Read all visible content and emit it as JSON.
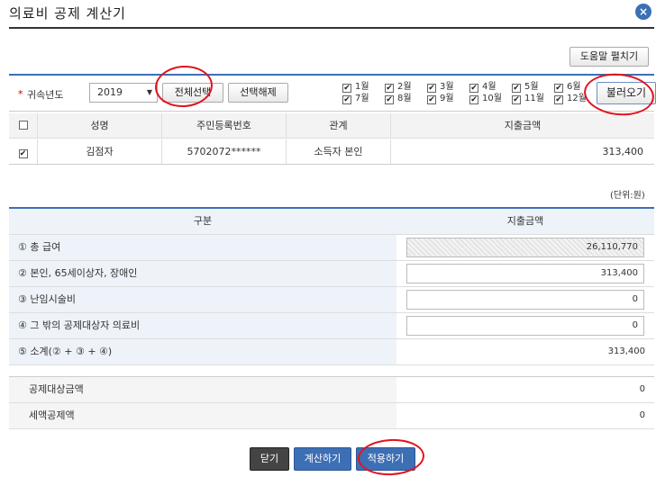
{
  "window": {
    "title": "의료비 공제 계산기",
    "close_label": "×"
  },
  "toolbar": {
    "help_label": "도움말 펼치기"
  },
  "filter": {
    "required_mark": "*",
    "year_label": "귀속년도",
    "year_value": "2019",
    "select_all_label": "전체선택",
    "deselect_label": "선택해제",
    "load_label": "불러오기",
    "months": [
      {
        "label": "1월",
        "checked": true
      },
      {
        "label": "2월",
        "checked": true
      },
      {
        "label": "3월",
        "checked": true
      },
      {
        "label": "4월",
        "checked": true
      },
      {
        "label": "5월",
        "checked": true
      },
      {
        "label": "6월",
        "checked": true
      },
      {
        "label": "7월",
        "checked": true
      },
      {
        "label": "8월",
        "checked": true
      },
      {
        "label": "9월",
        "checked": true
      },
      {
        "label": "10월",
        "checked": true
      },
      {
        "label": "11월",
        "checked": true
      },
      {
        "label": "12월",
        "checked": true
      }
    ]
  },
  "people_table": {
    "columns": [
      "성명",
      "주민등록번호",
      "관계",
      "지출금액"
    ],
    "rows": [
      {
        "checked": true,
        "name": "김점자",
        "id_number": "5702072******",
        "relation": "소득자 본인",
        "amount": "313,400"
      }
    ]
  },
  "unit_label": "(단위:원)",
  "calc_table": {
    "header_label": "구분",
    "header_amount": "지출금액",
    "rows": [
      {
        "label": "① 총 급여",
        "value": "26,110,770"
      },
      {
        "label": "② 본인, 65세이상자, 장애인",
        "value": "313,400"
      },
      {
        "label": "③ 난임시술비",
        "value": "0"
      },
      {
        "label": "④ 그 밖의 공제대상자 의료비",
        "value": "0"
      },
      {
        "label": "⑤ 소계(② + ③ + ④)",
        "value": "313,400"
      }
    ]
  },
  "result_table": {
    "rows": [
      {
        "label": "공제대상금액",
        "value": "0"
      },
      {
        "label": "세액공제액",
        "value": "0"
      }
    ]
  },
  "footer": {
    "close_label": "닫기",
    "calculate_label": "계산하기",
    "apply_label": "적용하기"
  },
  "colors": {
    "accent": "#3d6fb5",
    "annotation": "#e0141e"
  }
}
